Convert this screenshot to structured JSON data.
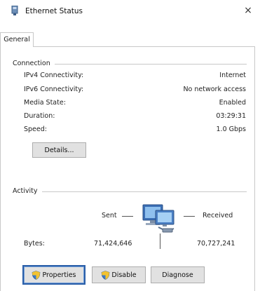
{
  "window": {
    "title": "Ethernet Status",
    "close_glyph": "×"
  },
  "tabs": [
    {
      "label": "General",
      "active": true
    }
  ],
  "connection": {
    "legend": "Connection",
    "rows": [
      {
        "label": "IPv4 Connectivity:",
        "value": "Internet"
      },
      {
        "label": "IPv6 Connectivity:",
        "value": "No network access"
      },
      {
        "label": "Media State:",
        "value": "Enabled"
      },
      {
        "label": "Duration:",
        "value": "03:29:31"
      },
      {
        "label": "Speed:",
        "value": "1.0 Gbps"
      }
    ],
    "details_button": "Details..."
  },
  "activity": {
    "legend": "Activity",
    "sent_label": "Sent",
    "received_label": "Received",
    "bytes_label": "Bytes:",
    "bytes_sent": "71,424,646",
    "bytes_received": "70,727,241"
  },
  "buttons": {
    "properties": "Properties",
    "disable": "Disable",
    "diagnose": "Diagnose"
  },
  "icons": {
    "title": "network-adapter-icon",
    "activity": "network-computers-icon",
    "shield": "uac-shield-icon"
  },
  "colors": {
    "focus_outline": "#2b5fa8",
    "button_face": "#e1e1e1",
    "border": "#c8c8c8"
  }
}
